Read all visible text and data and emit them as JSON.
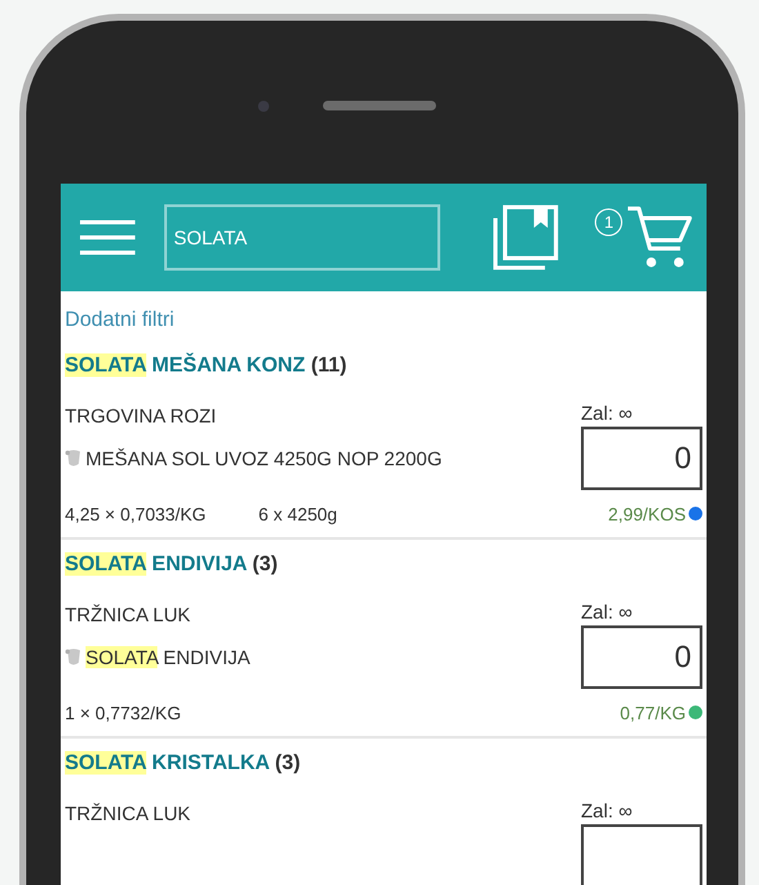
{
  "header": {
    "search": {
      "value": "SOLATA"
    },
    "cart_count": "1"
  },
  "filters_link": "Dodatni filtri",
  "products": [
    {
      "title": [
        {
          "text": "SOLATA",
          "highlighted": true
        },
        {
          "text": " MEŠANA KONZ",
          "highlighted": false
        }
      ],
      "count": "(11)",
      "store": "TRGOVINA ROZI",
      "stock": "Zal: ∞",
      "description": [
        {
          "text": "MEŠANA SOL UVOZ 4250G NOP 2200G",
          "highlighted": false
        }
      ],
      "quantity": "0",
      "unit_price": "4,25 × 0,7033/KG",
      "pack": "6 x 4250g",
      "price": "2,99/KOS",
      "color": "#1a73e8"
    },
    {
      "title": [
        {
          "text": "SOLATA",
          "highlighted": true
        },
        {
          "text": " ENDIVIJA",
          "highlighted": false
        }
      ],
      "count": "(3)",
      "store": "TRŽNICA LUK",
      "stock": "Zal: ∞",
      "description": [
        {
          "text": "SOLATA",
          "highlighted": true
        },
        {
          "text": " ENDIVIJA",
          "highlighted": false
        }
      ],
      "quantity": "0",
      "unit_price": "1 × 0,7732/KG",
      "price": "0,77/KG",
      "color": "#3cb878"
    },
    {
      "title": [
        {
          "text": "SOLATA",
          "highlighted": true
        },
        {
          "text": " KRISTALKA",
          "highlighted": false
        }
      ],
      "count": "(3)",
      "store": "TRŽNICA LUK",
      "stock": "Zal: ∞"
    }
  ]
}
